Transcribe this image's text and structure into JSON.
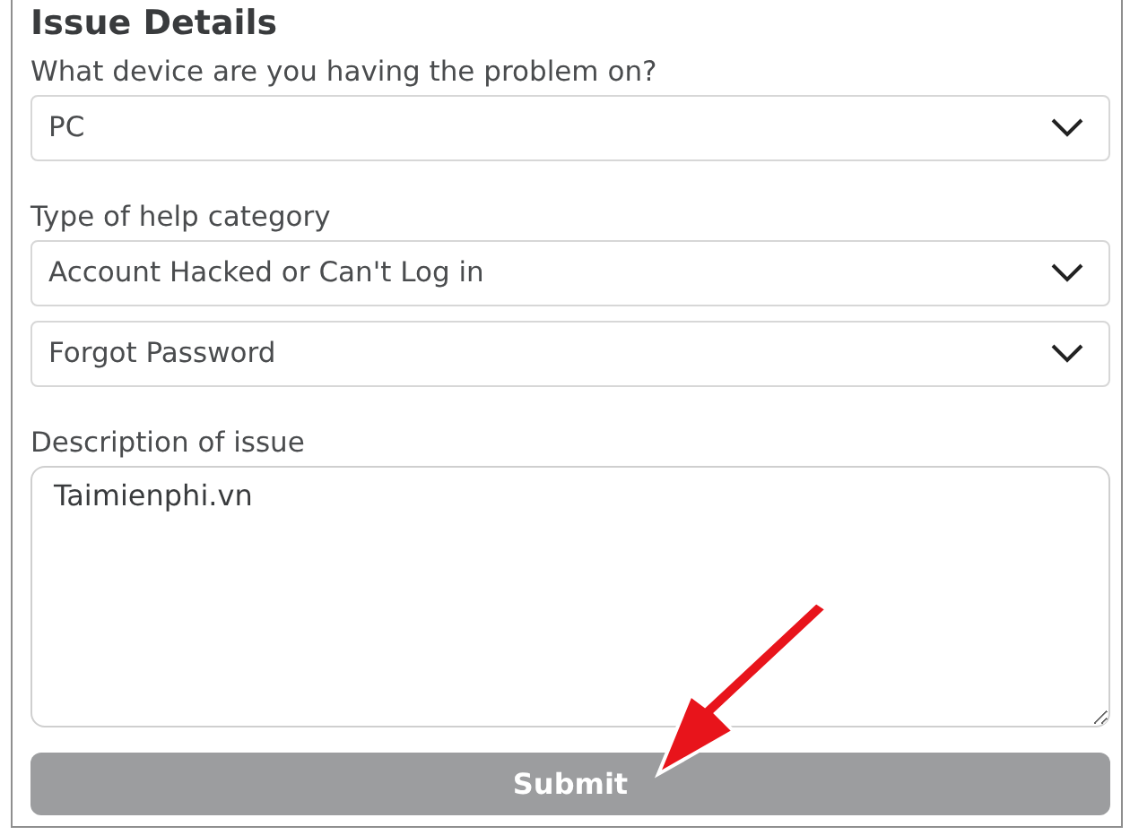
{
  "heading": "Issue Details",
  "fields": [
    {
      "kind": "select",
      "label": "What device are you having the problem on?",
      "value": "PC"
    },
    {
      "kind": "select",
      "label": "Type of help category",
      "value": "Account Hacked or Can't Log in"
    },
    {
      "kind": "select",
      "value": "Forgot Password"
    },
    {
      "kind": "textarea",
      "label": "Description of issue",
      "value": "Taimienphi.vn"
    }
  ],
  "submit": {
    "label": "Submit",
    "disabled": true
  }
}
